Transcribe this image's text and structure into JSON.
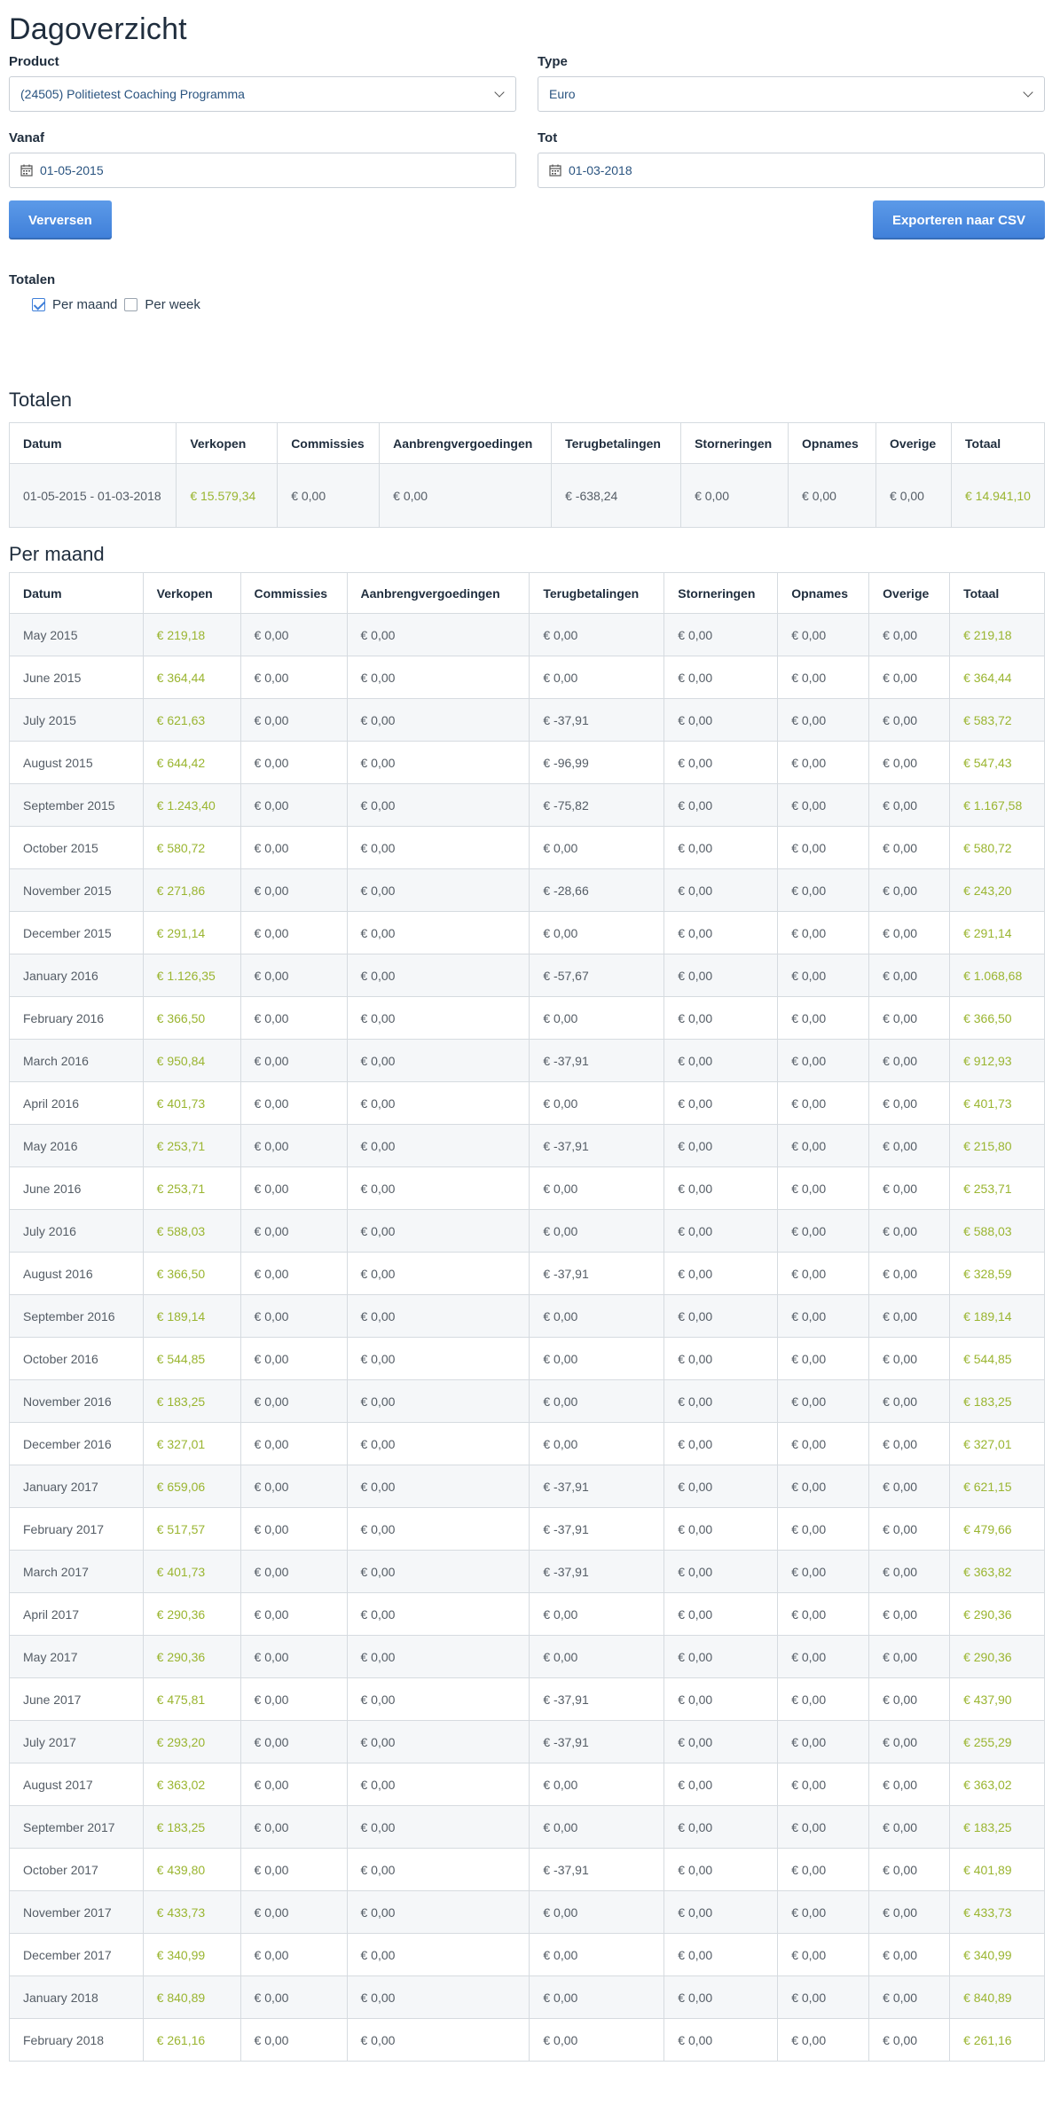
{
  "title": "Dagoverzicht",
  "filters": {
    "product_label": "Product",
    "product_value": "(24505) Politietest Coaching Programma",
    "type_label": "Type",
    "type_value": "Euro",
    "from_label": "Vanaf",
    "from_value": "01-05-2015",
    "to_label": "Tot",
    "to_value": "01-03-2018"
  },
  "buttons": {
    "refresh": "Verversen",
    "export": "Exporteren naar CSV"
  },
  "totals_options": {
    "label": "Totalen",
    "per_month": "Per maand",
    "per_month_checked": true,
    "per_week": "Per week",
    "per_week_checked": false
  },
  "colors": {
    "accent": "#3f7fd9",
    "positive": "#9ab530",
    "border": "#d6dbe0"
  },
  "columns": [
    "Datum",
    "Verkopen",
    "Commissies",
    "Aanbrengvergoedingen",
    "Terugbetalingen",
    "Storneringen",
    "Opnames",
    "Overige",
    "Totaal"
  ],
  "totals": {
    "title": "Totalen",
    "row": {
      "datum": "01-05-2015 - 01-03-2018",
      "verkopen": "€ 15.579,34",
      "commissies": "€ 0,00",
      "aanbreng": "€ 0,00",
      "terug": "€ -638,24",
      "storn": "€ 0,00",
      "opnames": "€ 0,00",
      "overige": "€ 0,00",
      "totaal": "€ 14.941,10"
    }
  },
  "per_month": {
    "title": "Per maand",
    "rows": [
      {
        "datum": "May 2015",
        "verkopen": "€ 219,18",
        "commissies": "€ 0,00",
        "aanbreng": "€ 0,00",
        "terug": "€ 0,00",
        "storn": "€ 0,00",
        "opnames": "€ 0,00",
        "overige": "€ 0,00",
        "totaal": "€ 219,18"
      },
      {
        "datum": "June 2015",
        "verkopen": "€ 364,44",
        "commissies": "€ 0,00",
        "aanbreng": "€ 0,00",
        "terug": "€ 0,00",
        "storn": "€ 0,00",
        "opnames": "€ 0,00",
        "overige": "€ 0,00",
        "totaal": "€ 364,44"
      },
      {
        "datum": "July 2015",
        "verkopen": "€ 621,63",
        "commissies": "€ 0,00",
        "aanbreng": "€ 0,00",
        "terug": "€ -37,91",
        "storn": "€ 0,00",
        "opnames": "€ 0,00",
        "overige": "€ 0,00",
        "totaal": "€ 583,72"
      },
      {
        "datum": "August 2015",
        "verkopen": "€ 644,42",
        "commissies": "€ 0,00",
        "aanbreng": "€ 0,00",
        "terug": "€ -96,99",
        "storn": "€ 0,00",
        "opnames": "€ 0,00",
        "overige": "€ 0,00",
        "totaal": "€ 547,43"
      },
      {
        "datum": "September 2015",
        "verkopen": "€ 1.243,40",
        "commissies": "€ 0,00",
        "aanbreng": "€ 0,00",
        "terug": "€ -75,82",
        "storn": "€ 0,00",
        "opnames": "€ 0,00",
        "overige": "€ 0,00",
        "totaal": "€ 1.167,58"
      },
      {
        "datum": "October 2015",
        "verkopen": "€ 580,72",
        "commissies": "€ 0,00",
        "aanbreng": "€ 0,00",
        "terug": "€ 0,00",
        "storn": "€ 0,00",
        "opnames": "€ 0,00",
        "overige": "€ 0,00",
        "totaal": "€ 580,72"
      },
      {
        "datum": "November 2015",
        "verkopen": "€ 271,86",
        "commissies": "€ 0,00",
        "aanbreng": "€ 0,00",
        "terug": "€ -28,66",
        "storn": "€ 0,00",
        "opnames": "€ 0,00",
        "overige": "€ 0,00",
        "totaal": "€ 243,20"
      },
      {
        "datum": "December 2015",
        "verkopen": "€ 291,14",
        "commissies": "€ 0,00",
        "aanbreng": "€ 0,00",
        "terug": "€ 0,00",
        "storn": "€ 0,00",
        "opnames": "€ 0,00",
        "overige": "€ 0,00",
        "totaal": "€ 291,14"
      },
      {
        "datum": "January 2016",
        "verkopen": "€ 1.126,35",
        "commissies": "€ 0,00",
        "aanbreng": "€ 0,00",
        "terug": "€ -57,67",
        "storn": "€ 0,00",
        "opnames": "€ 0,00",
        "overige": "€ 0,00",
        "totaal": "€ 1.068,68"
      },
      {
        "datum": "February 2016",
        "verkopen": "€ 366,50",
        "commissies": "€ 0,00",
        "aanbreng": "€ 0,00",
        "terug": "€ 0,00",
        "storn": "€ 0,00",
        "opnames": "€ 0,00",
        "overige": "€ 0,00",
        "totaal": "€ 366,50"
      },
      {
        "datum": "March 2016",
        "verkopen": "€ 950,84",
        "commissies": "€ 0,00",
        "aanbreng": "€ 0,00",
        "terug": "€ -37,91",
        "storn": "€ 0,00",
        "opnames": "€ 0,00",
        "overige": "€ 0,00",
        "totaal": "€ 912,93"
      },
      {
        "datum": "April 2016",
        "verkopen": "€ 401,73",
        "commissies": "€ 0,00",
        "aanbreng": "€ 0,00",
        "terug": "€ 0,00",
        "storn": "€ 0,00",
        "opnames": "€ 0,00",
        "overige": "€ 0,00",
        "totaal": "€ 401,73"
      },
      {
        "datum": "May 2016",
        "verkopen": "€ 253,71",
        "commissies": "€ 0,00",
        "aanbreng": "€ 0,00",
        "terug": "€ -37,91",
        "storn": "€ 0,00",
        "opnames": "€ 0,00",
        "overige": "€ 0,00",
        "totaal": "€ 215,80"
      },
      {
        "datum": "June 2016",
        "verkopen": "€ 253,71",
        "commissies": "€ 0,00",
        "aanbreng": "€ 0,00",
        "terug": "€ 0,00",
        "storn": "€ 0,00",
        "opnames": "€ 0,00",
        "overige": "€ 0,00",
        "totaal": "€ 253,71"
      },
      {
        "datum": "July 2016",
        "verkopen": "€ 588,03",
        "commissies": "€ 0,00",
        "aanbreng": "€ 0,00",
        "terug": "€ 0,00",
        "storn": "€ 0,00",
        "opnames": "€ 0,00",
        "overige": "€ 0,00",
        "totaal": "€ 588,03"
      },
      {
        "datum": "August 2016",
        "verkopen": "€ 366,50",
        "commissies": "€ 0,00",
        "aanbreng": "€ 0,00",
        "terug": "€ -37,91",
        "storn": "€ 0,00",
        "opnames": "€ 0,00",
        "overige": "€ 0,00",
        "totaal": "€ 328,59"
      },
      {
        "datum": "September 2016",
        "verkopen": "€ 189,14",
        "commissies": "€ 0,00",
        "aanbreng": "€ 0,00",
        "terug": "€ 0,00",
        "storn": "€ 0,00",
        "opnames": "€ 0,00",
        "overige": "€ 0,00",
        "totaal": "€ 189,14"
      },
      {
        "datum": "October 2016",
        "verkopen": "€ 544,85",
        "commissies": "€ 0,00",
        "aanbreng": "€ 0,00",
        "terug": "€ 0,00",
        "storn": "€ 0,00",
        "opnames": "€ 0,00",
        "overige": "€ 0,00",
        "totaal": "€ 544,85"
      },
      {
        "datum": "November 2016",
        "verkopen": "€ 183,25",
        "commissies": "€ 0,00",
        "aanbreng": "€ 0,00",
        "terug": "€ 0,00",
        "storn": "€ 0,00",
        "opnames": "€ 0,00",
        "overige": "€ 0,00",
        "totaal": "€ 183,25"
      },
      {
        "datum": "December 2016",
        "verkopen": "€ 327,01",
        "commissies": "€ 0,00",
        "aanbreng": "€ 0,00",
        "terug": "€ 0,00",
        "storn": "€ 0,00",
        "opnames": "€ 0,00",
        "overige": "€ 0,00",
        "totaal": "€ 327,01"
      },
      {
        "datum": "January 2017",
        "verkopen": "€ 659,06",
        "commissies": "€ 0,00",
        "aanbreng": "€ 0,00",
        "terug": "€ -37,91",
        "storn": "€ 0,00",
        "opnames": "€ 0,00",
        "overige": "€ 0,00",
        "totaal": "€ 621,15"
      },
      {
        "datum": "February 2017",
        "verkopen": "€ 517,57",
        "commissies": "€ 0,00",
        "aanbreng": "€ 0,00",
        "terug": "€ -37,91",
        "storn": "€ 0,00",
        "opnames": "€ 0,00",
        "overige": "€ 0,00",
        "totaal": "€ 479,66"
      },
      {
        "datum": "March 2017",
        "verkopen": "€ 401,73",
        "commissies": "€ 0,00",
        "aanbreng": "€ 0,00",
        "terug": "€ -37,91",
        "storn": "€ 0,00",
        "opnames": "€ 0,00",
        "overige": "€ 0,00",
        "totaal": "€ 363,82"
      },
      {
        "datum": "April 2017",
        "verkopen": "€ 290,36",
        "commissies": "€ 0,00",
        "aanbreng": "€ 0,00",
        "terug": "€ 0,00",
        "storn": "€ 0,00",
        "opnames": "€ 0,00",
        "overige": "€ 0,00",
        "totaal": "€ 290,36"
      },
      {
        "datum": "May 2017",
        "verkopen": "€ 290,36",
        "commissies": "€ 0,00",
        "aanbreng": "€ 0,00",
        "terug": "€ 0,00",
        "storn": "€ 0,00",
        "opnames": "€ 0,00",
        "overige": "€ 0,00",
        "totaal": "€ 290,36"
      },
      {
        "datum": "June 2017",
        "verkopen": "€ 475,81",
        "commissies": "€ 0,00",
        "aanbreng": "€ 0,00",
        "terug": "€ -37,91",
        "storn": "€ 0,00",
        "opnames": "€ 0,00",
        "overige": "€ 0,00",
        "totaal": "€ 437,90"
      },
      {
        "datum": "July 2017",
        "verkopen": "€ 293,20",
        "commissies": "€ 0,00",
        "aanbreng": "€ 0,00",
        "terug": "€ -37,91",
        "storn": "€ 0,00",
        "opnames": "€ 0,00",
        "overige": "€ 0,00",
        "totaal": "€ 255,29"
      },
      {
        "datum": "August 2017",
        "verkopen": "€ 363,02",
        "commissies": "€ 0,00",
        "aanbreng": "€ 0,00",
        "terug": "€ 0,00",
        "storn": "€ 0,00",
        "opnames": "€ 0,00",
        "overige": "€ 0,00",
        "totaal": "€ 363,02"
      },
      {
        "datum": "September 2017",
        "verkopen": "€ 183,25",
        "commissies": "€ 0,00",
        "aanbreng": "€ 0,00",
        "terug": "€ 0,00",
        "storn": "€ 0,00",
        "opnames": "€ 0,00",
        "overige": "€ 0,00",
        "totaal": "€ 183,25"
      },
      {
        "datum": "October 2017",
        "verkopen": "€ 439,80",
        "commissies": "€ 0,00",
        "aanbreng": "€ 0,00",
        "terug": "€ -37,91",
        "storn": "€ 0,00",
        "opnames": "€ 0,00",
        "overige": "€ 0,00",
        "totaal": "€ 401,89"
      },
      {
        "datum": "November 2017",
        "verkopen": "€ 433,73",
        "commissies": "€ 0,00",
        "aanbreng": "€ 0,00",
        "terug": "€ 0,00",
        "storn": "€ 0,00",
        "opnames": "€ 0,00",
        "overige": "€ 0,00",
        "totaal": "€ 433,73"
      },
      {
        "datum": "December 2017",
        "verkopen": "€ 340,99",
        "commissies": "€ 0,00",
        "aanbreng": "€ 0,00",
        "terug": "€ 0,00",
        "storn": "€ 0,00",
        "opnames": "€ 0,00",
        "overige": "€ 0,00",
        "totaal": "€ 340,99"
      },
      {
        "datum": "January 2018",
        "verkopen": "€ 840,89",
        "commissies": "€ 0,00",
        "aanbreng": "€ 0,00",
        "terug": "€ 0,00",
        "storn": "€ 0,00",
        "opnames": "€ 0,00",
        "overige": "€ 0,00",
        "totaal": "€ 840,89"
      },
      {
        "datum": "February 2018",
        "verkopen": "€ 261,16",
        "commissies": "€ 0,00",
        "aanbreng": "€ 0,00",
        "terug": "€ 0,00",
        "storn": "€ 0,00",
        "opnames": "€ 0,00",
        "overige": "€ 0,00",
        "totaal": "€ 261,16"
      }
    ]
  }
}
